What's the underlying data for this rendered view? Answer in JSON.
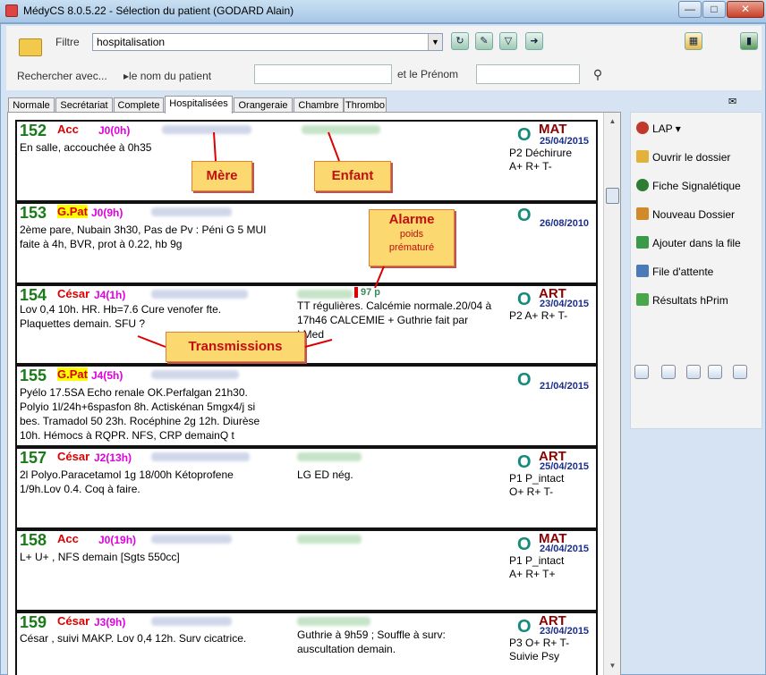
{
  "app": {
    "title": "MédyCS 8.0.5.22 - Sélection du patient (GODARD Alain)"
  },
  "window_controls": {
    "minimize": "—",
    "maximize": "□",
    "close": "✕"
  },
  "filter": {
    "label": "Filtre",
    "value": "hospitalisation"
  },
  "search": {
    "label": "Rechercher avec...",
    "by": "▸le nom du patient",
    "prenom_label": "et le Prénom",
    "name_value": "",
    "prenom_value": ""
  },
  "tabs": [
    "Normale",
    "Secrétariat",
    "Complete",
    "Hospitalisées",
    "Orangeraie",
    "Chambre",
    "Thrombo"
  ],
  "active_tab": "Hospitalisées",
  "cards": [
    {
      "num": "152",
      "type": "Acc",
      "day": "J0(0h)",
      "note": "En salle, accouchée à 0h35",
      "note2": "",
      "o": "O",
      "cat": "MAT",
      "date": "25/04/2015",
      "info": "P2 Déchirure\nA+ R+ T-"
    },
    {
      "num": "153",
      "type": "G.Pat",
      "day": "J0(9h)",
      "note": "2ème pare, Nubain 3h30, Pas de Pv : Péni G 5 MUI\nfaite à 4h, BVR, prot à 0.22, hb 9g",
      "note2": "",
      "o": "O",
      "cat": "",
      "date": "26/08/2010",
      "info": ""
    },
    {
      "num": "154",
      "type": "César",
      "day": "J4(1h)",
      "note": "Lov 0,4 10h. HR. Hb=7.6 Cure venofer fte.\nPlaquettes demain. SFU ?",
      "note2": "TT régulières. Calcémie normale.20/04 à\n17h46 CALCEMIE + Guthrie fait par\nI.Med",
      "o": "O",
      "cat": "ART",
      "date": "23/04/2015",
      "info": "P2 A+ R+ T-",
      "weight": "97 p"
    },
    {
      "num": "155",
      "type": "G.Pat",
      "day": "J4(5h)",
      "note": "Pyélo 17.5SA Echo renale OK.Perfalgan 21h30.\nPolyio 1l/24h+6spasfon 8h. Actiskénan 5mgx4/j si\nbes. Tramadol 50 23h. Rocéphine 2g 12h. Diurèse\n10h. Hémocs à RQPR. NFS, CRP demainQ t",
      "note2": "",
      "o": "O",
      "cat": "",
      "date": "21/04/2015",
      "info": ""
    },
    {
      "num": "157",
      "type": "César",
      "day": "J2(13h)",
      "note": "2l Polyo.Paracetamol 1g 18/00h Kétoprofene\n1/9h.Lov 0.4. Coq à faire.",
      "note2": "LG ED nég.",
      "o": "O",
      "cat": "ART",
      "date": "25/04/2015",
      "info": "P1 P_intact\nO+ R+ T-"
    },
    {
      "num": "158",
      "type": "Acc",
      "day": "J0(19h)",
      "note": "L+ U+ , NFS demain [Sgts 550cc]",
      "note2": "",
      "o": "O",
      "cat": "MAT",
      "date": "24/04/2015",
      "info": "P1 P_intact\nA+ R+ T+"
    },
    {
      "num": "159",
      "type": "César",
      "day": "J3(9h)",
      "note": "César , suivi MAKP. Lov 0,4 12h. Surv cicatrice.",
      "note2": "Guthrie à 9h59 ; Souffle à surv:\nauscultation demain.",
      "o": "O",
      "cat": "ART",
      "date": "23/04/2015",
      "info": "P3 O+ R+ T-\nSuivie Psy"
    }
  ],
  "callouts": {
    "mere": "Mère",
    "enfant": "Enfant",
    "alarme": "Alarme",
    "alarme_sub": "poids\nprématuré",
    "transmissions": "Transmissions"
  },
  "side_menu": [
    {
      "label": "LAP ▾",
      "icon": "pill-icon",
      "color": "#c0392b"
    },
    {
      "label": "Ouvrir le dossier",
      "icon": "open-folder-icon",
      "color": "#e2b23a"
    },
    {
      "label": "Fiche Signalétique",
      "icon": "person-icon",
      "color": "#2e7d32"
    },
    {
      "label": "Nouveau Dossier",
      "icon": "new-folder-icon",
      "color": "#d08a2a"
    },
    {
      "label": "Ajouter dans la file",
      "icon": "add-queue-icon",
      "color": "#3a9a4a"
    },
    {
      "label": "File d'attente",
      "icon": "hourglass-icon",
      "color": "#4a7ab8"
    },
    {
      "label": "Résultats hPrim",
      "icon": "flask-icon",
      "color": "#4aa64a"
    }
  ],
  "colors": {
    "accent": "#148a7a",
    "alarm": "#c01010",
    "callout": "#fbd870"
  }
}
